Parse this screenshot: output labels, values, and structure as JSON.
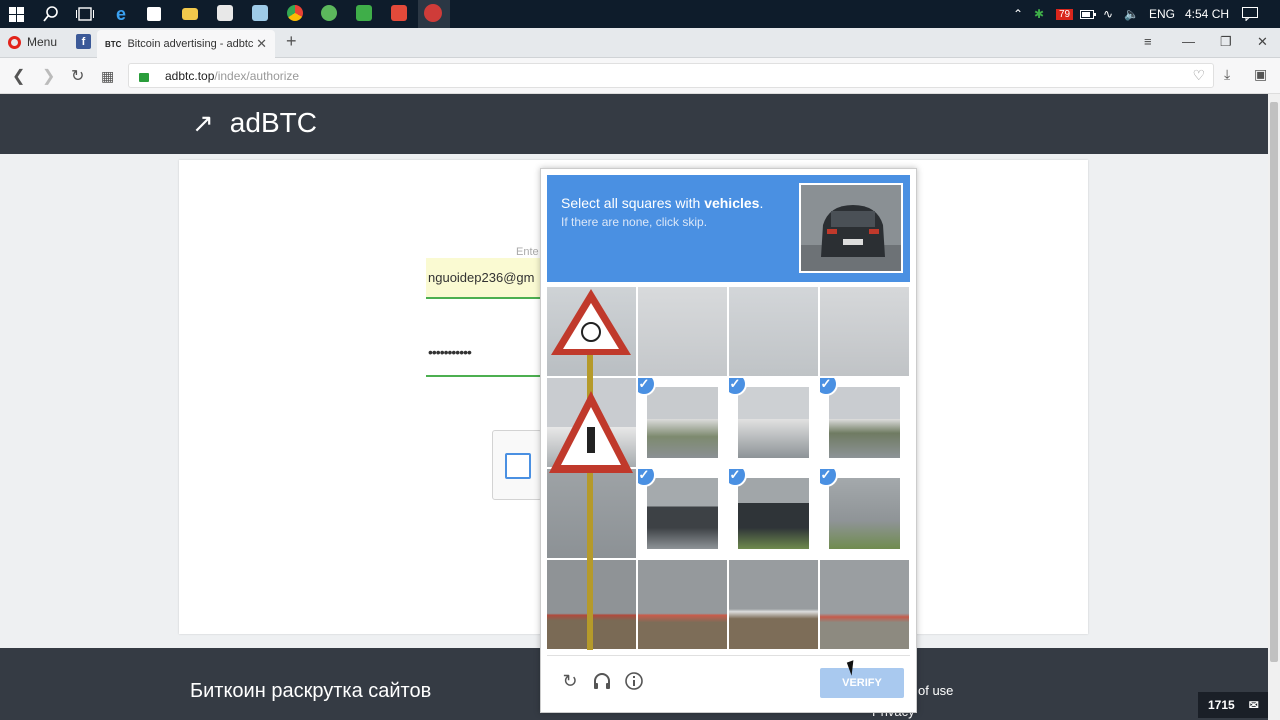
{
  "taskbar": {
    "language": "ENG",
    "time": "4:54 CH",
    "apps": [
      "windows-icon",
      "search-icon",
      "task-view-icon",
      "edge-icon",
      "store-icon",
      "explorer-icon",
      "app-icon",
      "notes-icon",
      "chrome-icon",
      "app-green-icon",
      "app-green2-icon",
      "app-red-icon",
      "opera-icon"
    ],
    "tray_badge": "79"
  },
  "browser": {
    "menu_label": "Menu",
    "active_tab_favicon": "BTC",
    "active_tab_title": "Bitcoin advertising - adbtc",
    "new_tab_label": "+",
    "url_host": "adbtc.top",
    "url_path": "/index/authorize"
  },
  "site": {
    "logo_arrow": "↗",
    "logo_text": "adBTC",
    "enter_label": "Ente",
    "email_value": "nguoidep236@gm",
    "password_mask": "•••••••••••",
    "footer_title": "Биткоин раскрутка сайтов",
    "footer_link_terms": "of use",
    "footer_link_privacy": "Privacy"
  },
  "captcha": {
    "title_prefix": "Select all squares with ",
    "title_keyword": "vehicles",
    "title_suffix": ".",
    "subtitle": "If there are none, click skip.",
    "selected_tiles": [
      5,
      6,
      7,
      9,
      10,
      11
    ],
    "verify_label": "VERIFY",
    "icons": [
      "reload-icon",
      "headphones-icon",
      "info-icon"
    ]
  },
  "status": {
    "counter": "1715"
  },
  "colors": {
    "recaptcha_blue": "#4a90e2",
    "site_header": "#353b44",
    "field_green": "#4caf50"
  }
}
